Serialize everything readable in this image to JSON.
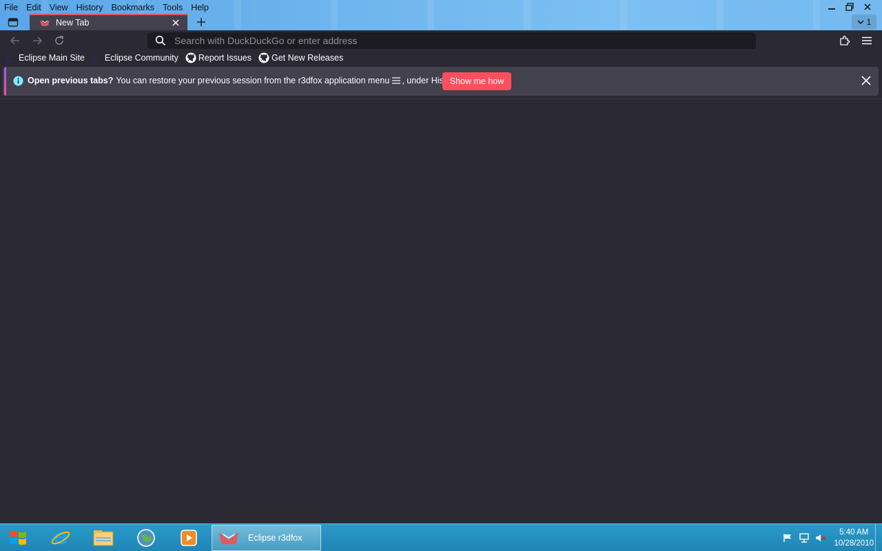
{
  "menubar": {
    "items": [
      {
        "label": "File"
      },
      {
        "label": "Edit"
      },
      {
        "label": "View"
      },
      {
        "label": "History"
      },
      {
        "label": "Bookmarks"
      },
      {
        "label": "Tools"
      },
      {
        "label": "Help"
      }
    ]
  },
  "tabs": {
    "active": {
      "title": "New Tab"
    },
    "all_tabs_count": "1"
  },
  "urlbar": {
    "placeholder": "Search with DuckDuckGo or enter address"
  },
  "bookmarks": [
    {
      "label": "Eclipse Main Site",
      "icon": "eclipse-icon"
    },
    {
      "label": "Eclipse Community",
      "icon": "eclipse-icon"
    },
    {
      "label": "Report Issues",
      "icon": "github-icon"
    },
    {
      "label": "Get New Releases",
      "icon": "github-icon"
    }
  ],
  "notification": {
    "bold": "Open previous tabs?",
    "text_before": "You can restore your previous session from the r3dfox application menu",
    "text_after": ", under History.",
    "button": "Show me how"
  },
  "taskbar": {
    "active_app": "Eclipse r3dfox",
    "pinned": [
      "internet-explorer-icon",
      "file-explorer-icon",
      "network-globe-icon",
      "media-player-icon"
    ]
  },
  "clock": {
    "time": "5:40 AM",
    "date": "10/28/2010"
  },
  "colors": {
    "accent_red": "#ff4f5e",
    "toolbar_bg": "#2b2a33",
    "tab_bg": "#42414d",
    "taskbar_bg": "#1f86b6"
  }
}
